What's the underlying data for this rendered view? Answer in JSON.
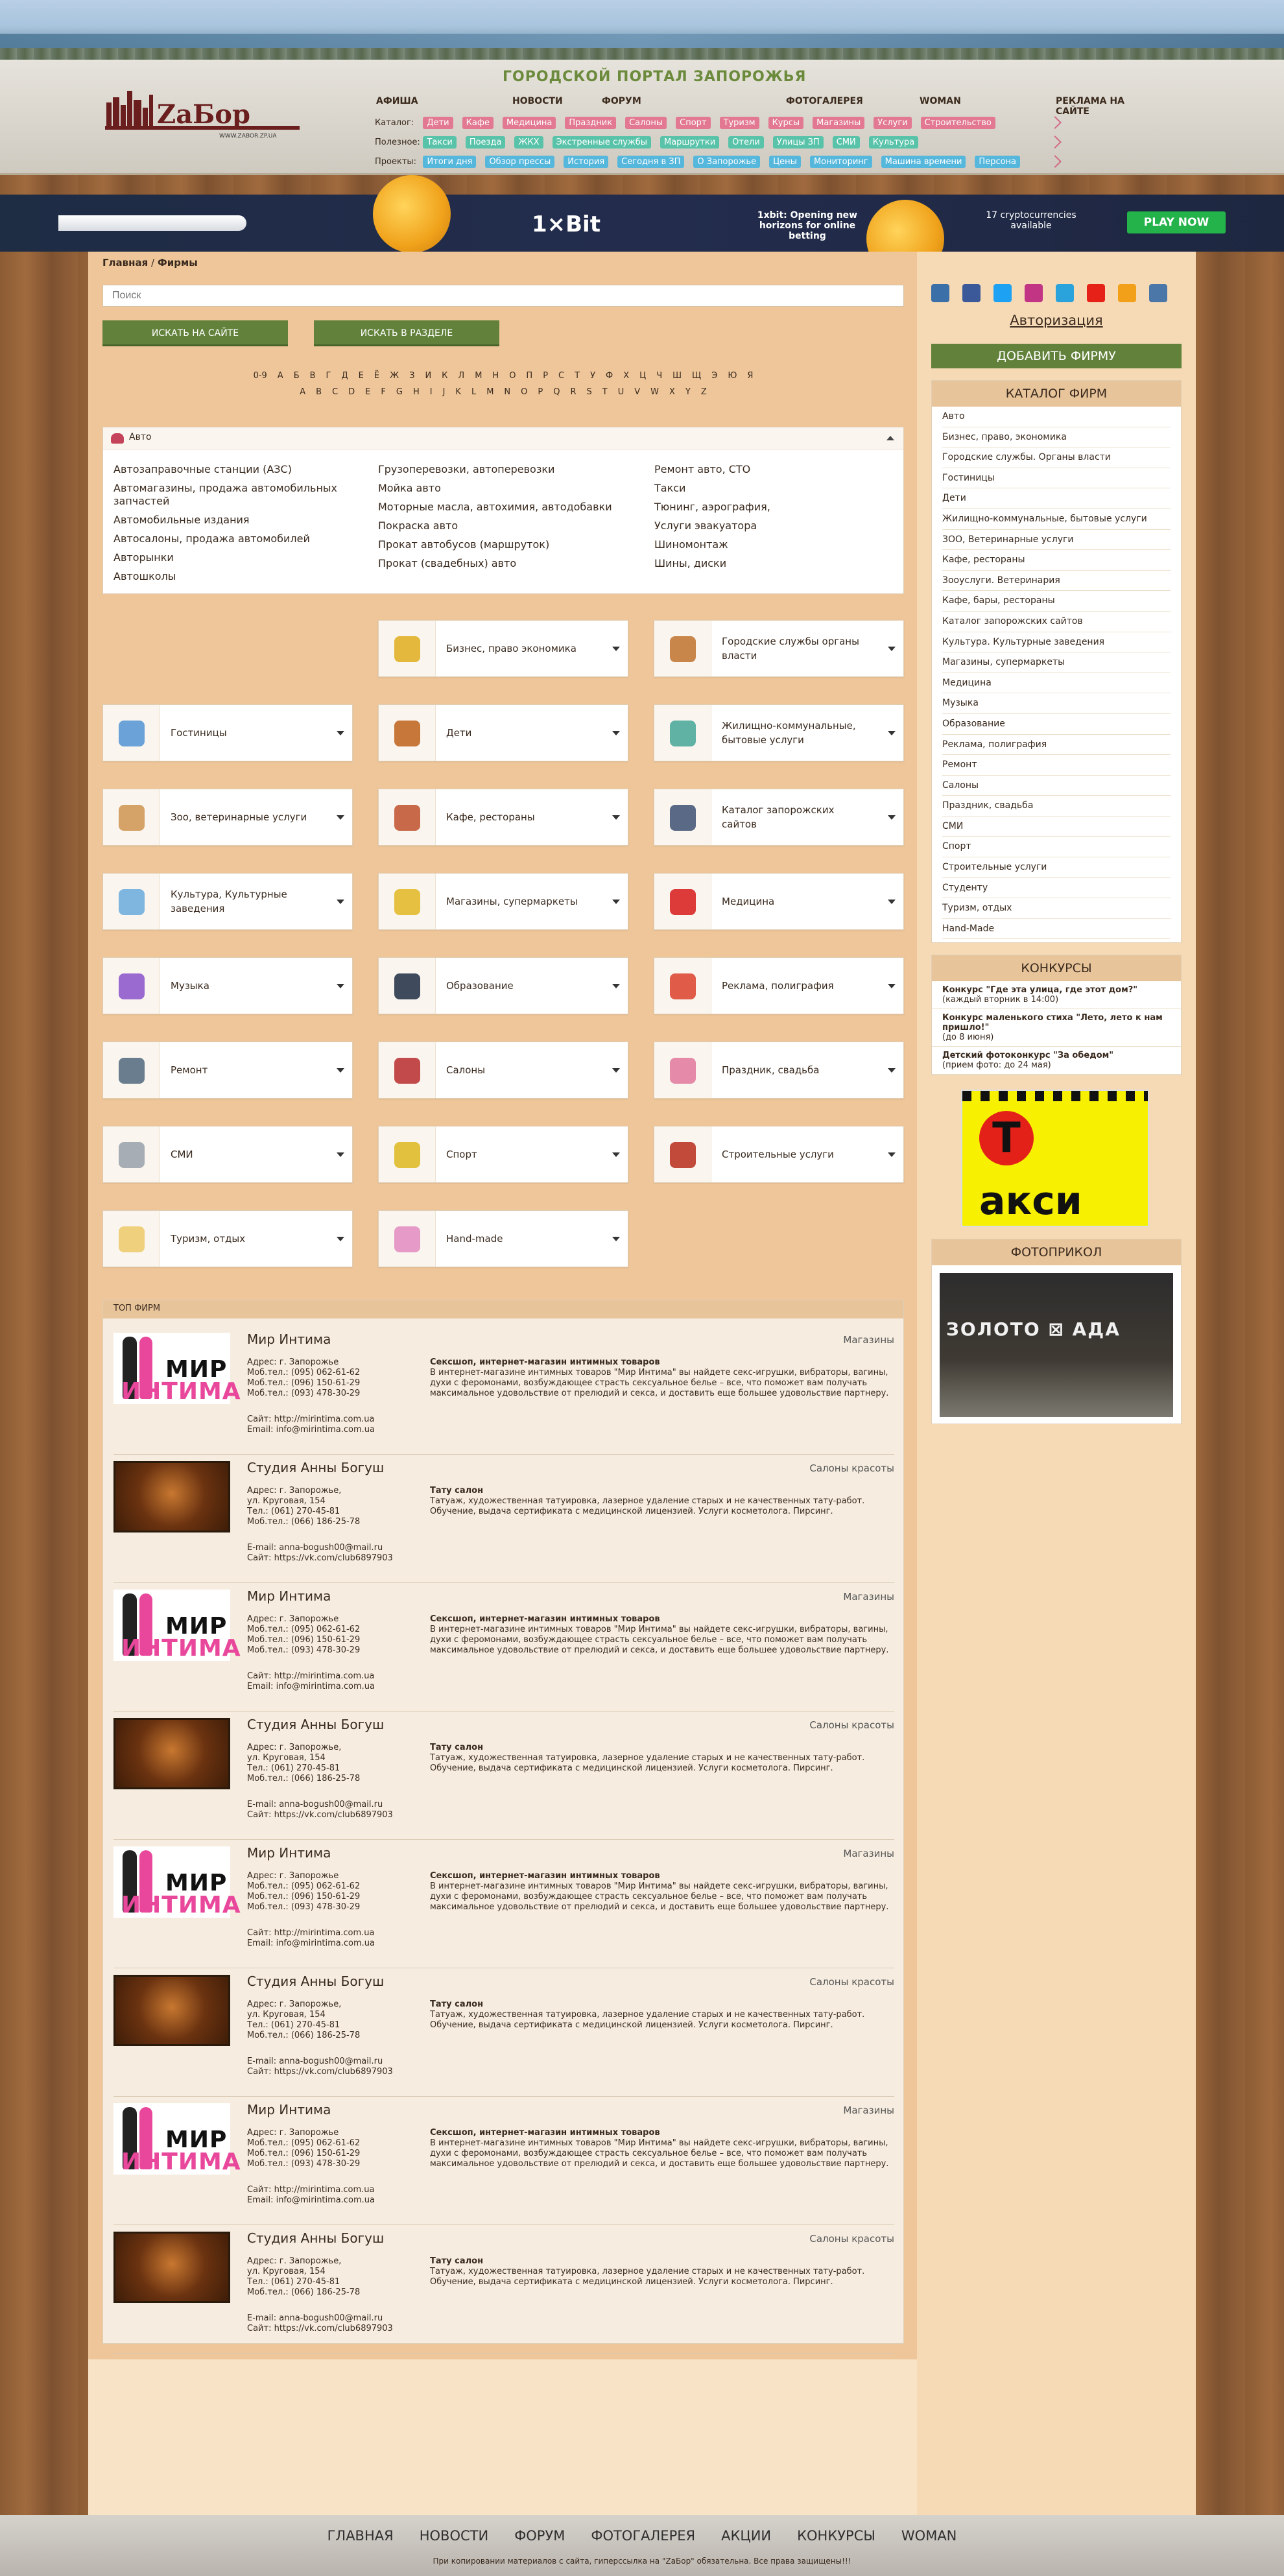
{
  "header": {
    "portal_title": "ГОРОДСКОЙ ПОРТАЛ ЗАПОРОЖЬЯ",
    "logo_text": "ZaБор",
    "logo_sub": "WWW.ZABOR.ZP.UA",
    "nav": [
      "АФИША",
      "НОВОСТИ",
      "ФОРУМ",
      "ФОТОГАЛЕРЕЯ",
      "WOMAN",
      "РЕКЛАМА НА САЙТЕ"
    ],
    "rows": [
      {
        "label": "Каталог:",
        "tags": [
          "Дети",
          "Кафе",
          "Медицина",
          "Праздник",
          "Салоны",
          "Спорт",
          "Туризм",
          "Курсы",
          "Магазины",
          "Услуги",
          "Строительство"
        ],
        "color": "#e27891"
      },
      {
        "label": "Полезное:",
        "tags": [
          "Такси",
          "Поезда",
          "ЖКХ",
          "Экстренные службы",
          "Маршрутки",
          "Отели",
          "Улицы ЗП",
          "СМИ",
          "Культура"
        ],
        "color": "#58c3a9"
      },
      {
        "label": "Проекты:",
        "tags": [
          "Итоги дня",
          "Обзор прессы",
          "История",
          "Сегодня в ЗП",
          "О Запорожье",
          "Цены",
          "Мониторинг",
          "Машина времени",
          "Персона"
        ],
        "color": "#56b7dc"
      }
    ]
  },
  "banner": {
    "brand": "1×Bit",
    "text1": "1xbit: Opening new horizons for online betting",
    "text2": "17 cryptocurrencies available",
    "cta": "PLAY NOW"
  },
  "breadcrumb": {
    "home": "Главная",
    "sep": " / ",
    "current": "Фирмы"
  },
  "search": {
    "placeholder": "Поиск",
    "btn_site": "ИСКАТЬ НА САЙТЕ",
    "btn_section": "ИСКАТЬ В РАЗДЕЛЕ"
  },
  "alphabet": {
    "cyr": [
      "0-9",
      "А",
      "Б",
      "В",
      "Г",
      "Д",
      "Е",
      "Ё",
      "Ж",
      "З",
      "И",
      "К",
      "Л",
      "М",
      "Н",
      "О",
      "П",
      "Р",
      "С",
      "Т",
      "У",
      "Ф",
      "Х",
      "Ц",
      "Ч",
      "Ш",
      "Щ",
      "Э",
      "Ю",
      "Я"
    ],
    "lat": [
      "A",
      "B",
      "C",
      "D",
      "E",
      "F",
      "G",
      "H",
      "I",
      "J",
      "K",
      "L",
      "M",
      "N",
      "O",
      "P",
      "Q",
      "R",
      "S",
      "T",
      "U",
      "V",
      "W",
      "X",
      "Y",
      "Z"
    ]
  },
  "auto": {
    "title": "Авто",
    "col1": [
      "Автозаправочные станции (АЗС)",
      "Автомагазины, продажа автомобильных",
      "запчастей",
      "Автомобильные издания",
      "Автосалоны, продажа автомобилей",
      "Авторынки",
      "Автошколы"
    ],
    "col2": [
      "Грузоперевозки, автоперевозки",
      "Мойка авто",
      "Моторные масла, автохимия, автодобавки",
      "Покраска авто",
      "Прокат автобусов (маршруток)",
      "Прокат (свадебных) авто"
    ],
    "col3": [
      "Ремонт авто, СТО",
      "Такси",
      "Тюнинг, аэрография,",
      "Услуги эвакуатора",
      "Шиномонтаж",
      "Шины, диски"
    ]
  },
  "categories": [
    {
      "name": "Бизнес, право экономика",
      "icon": "coins-icon",
      "color": "#e4b83c"
    },
    {
      "name": "Городские службы органы власти",
      "icon": "city-hall-icon",
      "color": "#c9864a"
    },
    {
      "name": "Гостиницы",
      "icon": "hotel-icon",
      "color": "#6ba2d8"
    },
    {
      "name": "Дети",
      "icon": "teddy-bear-icon",
      "color": "#c8773a"
    },
    {
      "name": "Жилищно-коммунальные, бытовые услуги",
      "icon": "house-icon",
      "color": "#5fb2a4"
    },
    {
      "name": "Зоо, ветеринарные услуги",
      "icon": "dog-icon",
      "color": "#d5a268"
    },
    {
      "name": "Кафе, рестораны",
      "icon": "cafe-icon",
      "color": "#c86a4a"
    },
    {
      "name": "Каталог запорожских сайтов",
      "icon": "monitor-icon",
      "color": "#5a6a86"
    },
    {
      "name": "Культура, Культурные заведения",
      "icon": "masks-icon",
      "color": "#7fb6e0"
    },
    {
      "name": "Магазины, супермаркеты",
      "icon": "shopping-bag-icon",
      "color": "#e6c040"
    },
    {
      "name": "Медицина",
      "icon": "medical-cross-icon",
      "color": "#dd3a3a"
    },
    {
      "name": "Музыка",
      "icon": "microphone-icon",
      "color": "#9a6ad0"
    },
    {
      "name": "Образование",
      "icon": "graduation-cap-icon",
      "color": "#3f4a5c"
    },
    {
      "name": "Реклама, полиграфия",
      "icon": "billboard-icon",
      "color": "#e05b48"
    },
    {
      "name": "Ремонт",
      "icon": "tools-icon",
      "color": "#6a7d8e"
    },
    {
      "name": "Салоны",
      "icon": "scissors-icon",
      "color": "#c24a4a"
    },
    {
      "name": "Праздник, свадьба",
      "icon": "party-icon",
      "color": "#e58aa9"
    },
    {
      "name": "СМИ",
      "icon": "newspaper-icon",
      "color": "#a7adb4"
    },
    {
      "name": "Спорт",
      "icon": "trophy-icon",
      "color": "#e1c13d"
    },
    {
      "name": "Строительные услуги",
      "icon": "bricks-icon",
      "color": "#c24a3a"
    },
    {
      "name": "Туризм, отдых",
      "icon": "map-icon",
      "color": "#efd07c"
    },
    {
      "name": "Hand-made",
      "icon": "yarn-icon",
      "color": "#e59ac7"
    }
  ],
  "top_firms": {
    "title": "ТОП ФИРМ",
    "items": [
      {
        "type": "mir",
        "name": "Мир Интима",
        "category": "Магазины",
        "address": "Адрес: г. Запорожье",
        "phones": [
          "Моб.тел.: (095) 062-61-62",
          "Моб.тел.: (096) 150-61-29",
          "Моб.тел.: (093) 478-30-29"
        ],
        "site": "Сайт: http://mirintima.com.ua",
        "email": "Email: info@mirintima.com.ua",
        "desc_title": "Сексшоп, интернет-магазин интимных товаров",
        "desc": "В интернет-магазине интимных товаров \"Мир Интима\" вы найдете секс-игрушки, вибраторы, вагины, духи с феромонами, возбуждающее страсть сексуальное белье – все, что поможет вам получать максимальное удовольствие от прелюдий и секса, и доставить еще большее удовольствие партнеру."
      },
      {
        "type": "tat",
        "name": "Студия Анны Богуш",
        "category": "Салоны красоты",
        "address": "Адрес: г. Запорожье,",
        "phones": [
          "ул. Круговая, 154",
          "Тел.: (061) 270-45-81",
          "Моб.тел.: (066) 186-25-78"
        ],
        "site": "E-mail: anna-bogush00@mail.ru",
        "email": "Сайт: https://vk.com/club6897903",
        "desc_title": "Тату салон",
        "desc": "Татуаж, художественная татуировка, лазерное удаление старых и не качественных тату-работ. Обучение, выдача сертификата с медицинской лицензией. Услуги косметолога. Пирсинг."
      },
      {
        "type": "mir",
        "name": "Мир Интима",
        "category": "Магазины",
        "address": "Адрес: г. Запорожье",
        "phones": [
          "Моб.тел.: (095) 062-61-62",
          "Моб.тел.: (096) 150-61-29",
          "Моб.тел.: (093) 478-30-29"
        ],
        "site": "Сайт: http://mirintima.com.ua",
        "email": "Email: info@mirintima.com.ua",
        "desc_title": "Сексшоп, интернет-магазин интимных товаров",
        "desc": "В интернет-магазине интимных товаров \"Мир Интима\" вы найдете секс-игрушки, вибраторы, вагины, духи с феромонами, возбуждающее страсть сексуальное белье – все, что поможет вам получать максимальное удовольствие от прелюдий и секса, и доставить еще большее удовольствие партнеру."
      },
      {
        "type": "tat",
        "name": "Студия Анны Богуш",
        "category": "Салоны красоты",
        "address": "Адрес: г. Запорожье,",
        "phones": [
          "ул. Круговая, 154",
          "Тел.: (061) 270-45-81",
          "Моб.тел.: (066) 186-25-78"
        ],
        "site": "E-mail: anna-bogush00@mail.ru",
        "email": "Сайт: https://vk.com/club6897903",
        "desc_title": "Тату салон",
        "desc": "Татуаж, художественная татуировка, лазерное удаление старых и не качественных тату-работ. Обучение, выдача сертификата с медицинской лицензией. Услуги косметолога. Пирсинг."
      },
      {
        "type": "mir",
        "name": "Мир Интима",
        "category": "Магазины",
        "address": "Адрес: г. Запорожье",
        "phones": [
          "Моб.тел.: (095) 062-61-62",
          "Моб.тел.: (096) 150-61-29",
          "Моб.тел.: (093) 478-30-29"
        ],
        "site": "Сайт: http://mirintima.com.ua",
        "email": "Email: info@mirintima.com.ua",
        "desc_title": "Сексшоп, интернет-магазин интимных товаров",
        "desc": "В интернет-магазине интимных товаров \"Мир Интима\" вы найдете секс-игрушки, вибраторы, вагины, духи с феромонами, возбуждающее страсть сексуальное белье – все, что поможет вам получать максимальное удовольствие от прелюдий и секса, и доставить еще большее удовольствие партнеру."
      },
      {
        "type": "tat",
        "name": "Студия Анны Богуш",
        "category": "Салоны красоты",
        "address": "Адрес: г. Запорожье,",
        "phones": [
          "ул. Круговая, 154",
          "Тел.: (061) 270-45-81",
          "Моб.тел.: (066) 186-25-78"
        ],
        "site": "E-mail: anna-bogush00@mail.ru",
        "email": "Сайт: https://vk.com/club6897903",
        "desc_title": "Тату салон",
        "desc": "Татуаж, художественная татуировка, лазерное удаление старых и не качественных тату-работ. Обучение, выдача сертификата с медицинской лицензией. Услуги косметолога. Пирсинг."
      },
      {
        "type": "mir",
        "name": "Мир Интима",
        "category": "Магазины",
        "address": "Адрес: г. Запорожье",
        "phones": [
          "Моб.тел.: (095) 062-61-62",
          "Моб.тел.: (096) 150-61-29",
          "Моб.тел.: (093) 478-30-29"
        ],
        "site": "Сайт: http://mirintima.com.ua",
        "email": "Email: info@mirintima.com.ua",
        "desc_title": "Сексшоп, интернет-магазин интимных товаров",
        "desc": "В интернет-магазине интимных товаров \"Мир Интима\" вы найдете секс-игрушки, вибраторы, вагины, духи с феромонами, возбуждающее страсть сексуальное белье – все, что поможет вам получать максимальное удовольствие от прелюдий и секса, и доставить еще большее удовольствие партнеру."
      },
      {
        "type": "tat",
        "name": "Студия Анны Богуш",
        "category": "Салоны красоты",
        "address": "Адрес: г. Запорожье,",
        "phones": [
          "ул. Круговая, 154",
          "Тел.: (061) 270-45-81",
          "Моб.тел.: (066) 186-25-78"
        ],
        "site": "E-mail: anna-bogush00@mail.ru",
        "email": "Сайт: https://vk.com/club6897903",
        "desc_title": "Тату салон",
        "desc": "Татуаж, художественная татуировка, лазерное удаление старых и не качественных тату-работ. Обучение, выдача сертификата с медицинской лицензией. Услуги косметолога. Пирсинг."
      }
    ]
  },
  "sidebar": {
    "social": [
      {
        "icon": "odnoklassniki-icon",
        "color": "#3b6fa8"
      },
      {
        "icon": "facebook-icon",
        "color": "#3b5998"
      },
      {
        "icon": "twitter-icon",
        "color": "#1da1f2"
      },
      {
        "icon": "instagram-icon",
        "color": "#c13584"
      },
      {
        "icon": "telegram-icon",
        "color": "#2aa3dc"
      },
      {
        "icon": "youtube-icon",
        "color": "#e62117"
      },
      {
        "icon": "ok-icon",
        "color": "#f2a01a"
      },
      {
        "icon": "vk-icon",
        "color": "#4a76a8"
      }
    ],
    "auth": "Авторизация",
    "add_firm": "ДОБАВИТЬ ФИРМУ",
    "catalog_title": "КАТАЛОГ ФИРМ",
    "catalog": [
      "Авто",
      "Бизнес, право, экономика",
      "Городские службы. Органы власти",
      "Гостиницы",
      "Дети",
      "Жилищно-коммунальные, бытовые услуги",
      "ЗОО, Ветеринарные услуги",
      "Кафе, рестораны",
      "Зооуслуги. Ветеринария",
      "Кафе, бары, рестораны",
      "Каталог запорожских сайтов",
      "Культура. Культурные заведения",
      "Магазины, супермаркеты",
      "Медицина",
      "Музыка",
      "Образование",
      "Реклама, полиграфия",
      "Ремонт",
      "Салоны",
      "Праздник, свадьба",
      "СМИ",
      "Спорт",
      "Строительные услуги",
      "Студенту",
      "Туризм, отдых",
      "Hand-Made"
    ],
    "contests_title": "КОНКУРСЫ",
    "contests": [
      {
        "title": "Конкурс \"Где эта улица, где этот дом?\"",
        "sub": "(каждый вторник в 14:00)"
      },
      {
        "title": "Конкурс маленького стиха \"Лето, лето к нам пришло!\"",
        "sub": "(до 8 июня)"
      },
      {
        "title": "Детский фотоконкурс \"За обедом\"",
        "sub": "(прием фото: до 24 мая)"
      }
    ],
    "taxi": "Такси",
    "photo_title": "ФОТОПРИКОЛ",
    "photo_sign": "ЗОЛОТО ⊠ АДА"
  },
  "footer": {
    "nav": [
      "ГЛАВНАЯ",
      "НОВОСТИ",
      "ФОРУМ",
      "ФОТОГАЛЕРЕЯ",
      "АКЦИИ",
      "КОНКУРСЫ",
      "WOMAN"
    ],
    "copy": "При копировании материалов с сайта, гиперссылка на \"ZaБор\" обязательна. Все права защищены!!!"
  }
}
